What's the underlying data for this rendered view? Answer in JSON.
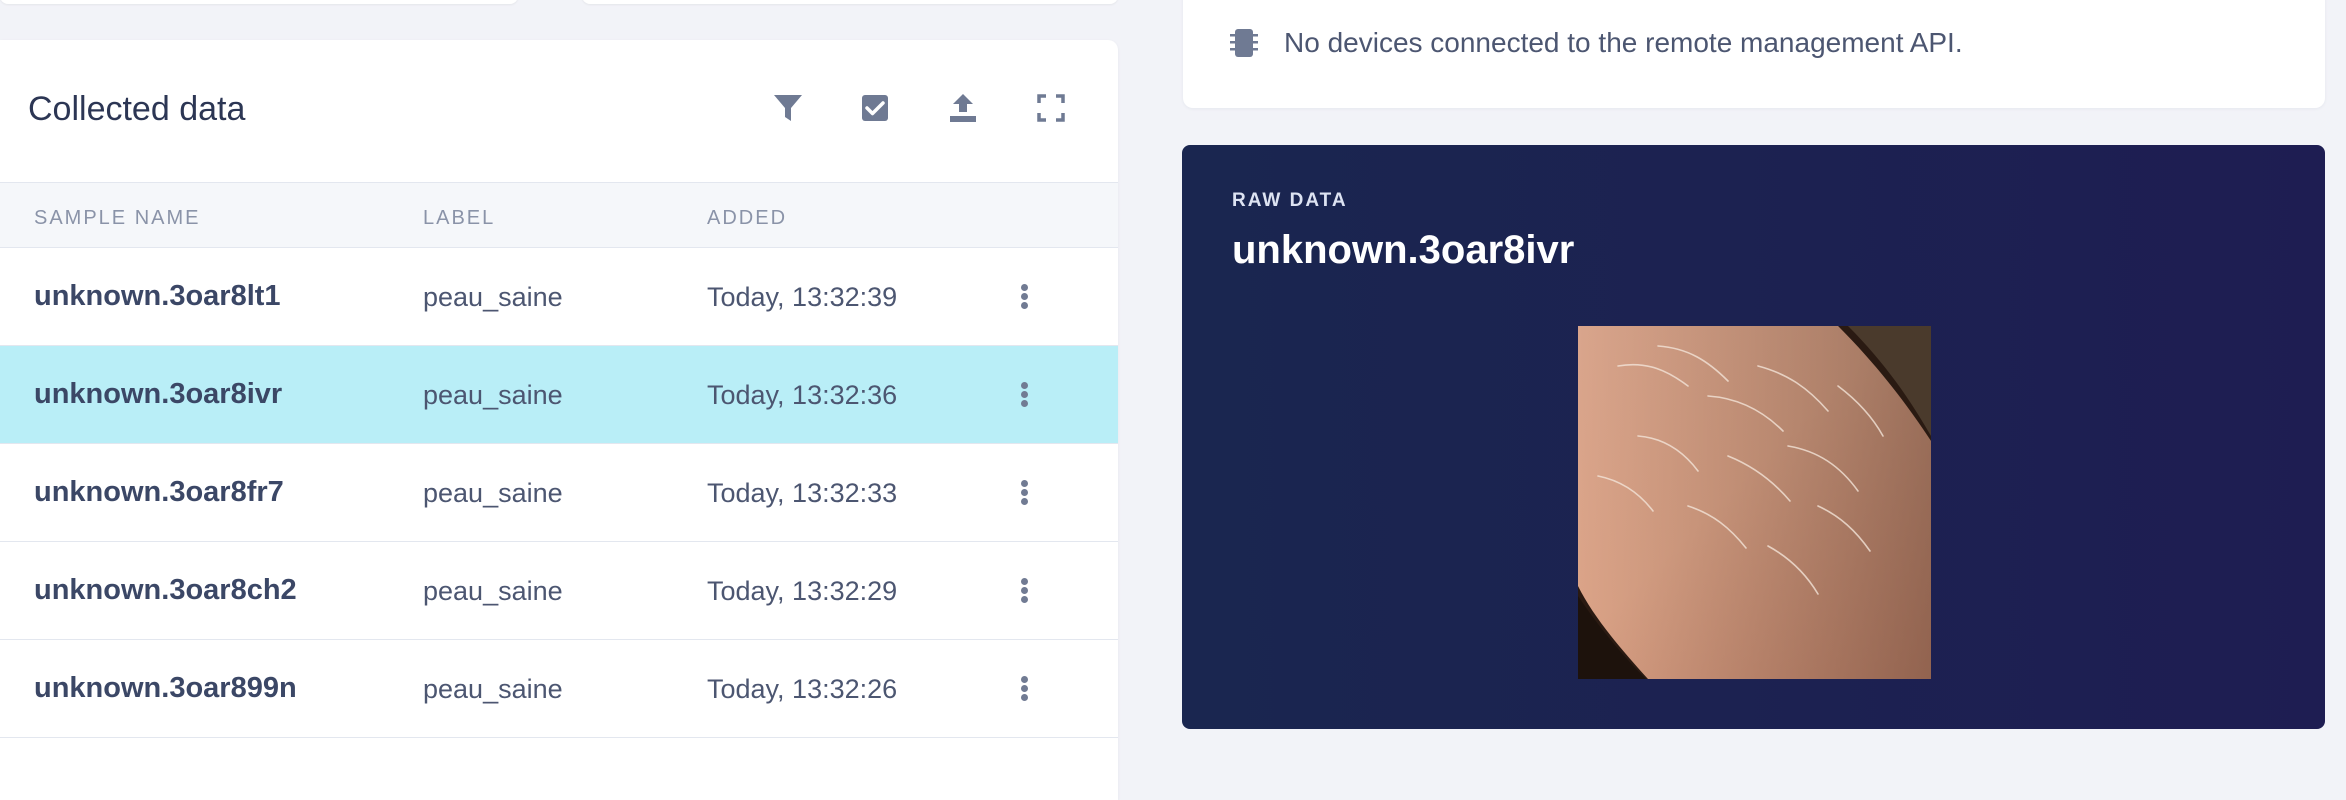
{
  "collected_data": {
    "title": "Collected data",
    "toolbar": {
      "filter_icon": "filter-icon",
      "select_icon": "checkbox-icon",
      "upload_icon": "upload-icon",
      "expand_icon": "fullscreen-icon"
    },
    "columns": [
      "SAMPLE NAME",
      "LABEL",
      "ADDED"
    ],
    "rows": [
      {
        "name": "unknown.3oar8lt1",
        "label": "peau_saine",
        "added": "Today, 13:32:39",
        "selected": false
      },
      {
        "name": "unknown.3oar8ivr",
        "label": "peau_saine",
        "added": "Today, 13:32:36",
        "selected": true
      },
      {
        "name": "unknown.3oar8fr7",
        "label": "peau_saine",
        "added": "Today, 13:32:33",
        "selected": false
      },
      {
        "name": "unknown.3oar8ch2",
        "label": "peau_saine",
        "added": "Today, 13:32:29",
        "selected": false
      },
      {
        "name": "unknown.3oar899n",
        "label": "peau_saine",
        "added": "Today, 13:32:26",
        "selected": false
      }
    ]
  },
  "devices": {
    "icon": "chip-icon",
    "message": "No devices connected to the remote management API."
  },
  "raw_data": {
    "kicker": "RAW DATA",
    "title": "unknown.3oar8ivr",
    "image": "skin-photo"
  },
  "colors": {
    "selected_row": "#b9eef7",
    "raw_panel": "#1b2450",
    "page_bg": "#f2f3f8"
  }
}
